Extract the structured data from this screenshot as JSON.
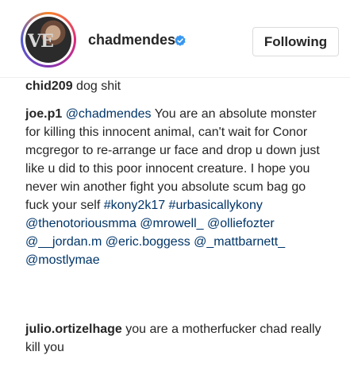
{
  "header": {
    "username": "chadmendes",
    "follow_label": "Following",
    "avatar_logo": "VE"
  },
  "comments": [
    {
      "author": "chid209",
      "text": "dog shit"
    },
    {
      "author": "joe.p1",
      "mention": "@chadmendes",
      "text": "You are an absolute monster for killing this innocent animal, can't wait for Conor mcgregor to re-arrange ur face and drop u down just like u did to this poor innocent creature. I hope you never win another fight you absolute scum bag go fuck your self",
      "tags": "#kony2k17 #urbasicallykony @thenotoriousmma @mrowell_ @olliefozter @__jordan.m @eric.boggess @_mattbarnett_ @mostlymae"
    },
    {
      "author": "julio.ortizelhage",
      "text": "you are a motherfucker chad really kill you"
    }
  ],
  "colors": {
    "link": "#003569",
    "verified": "#3897f0"
  }
}
